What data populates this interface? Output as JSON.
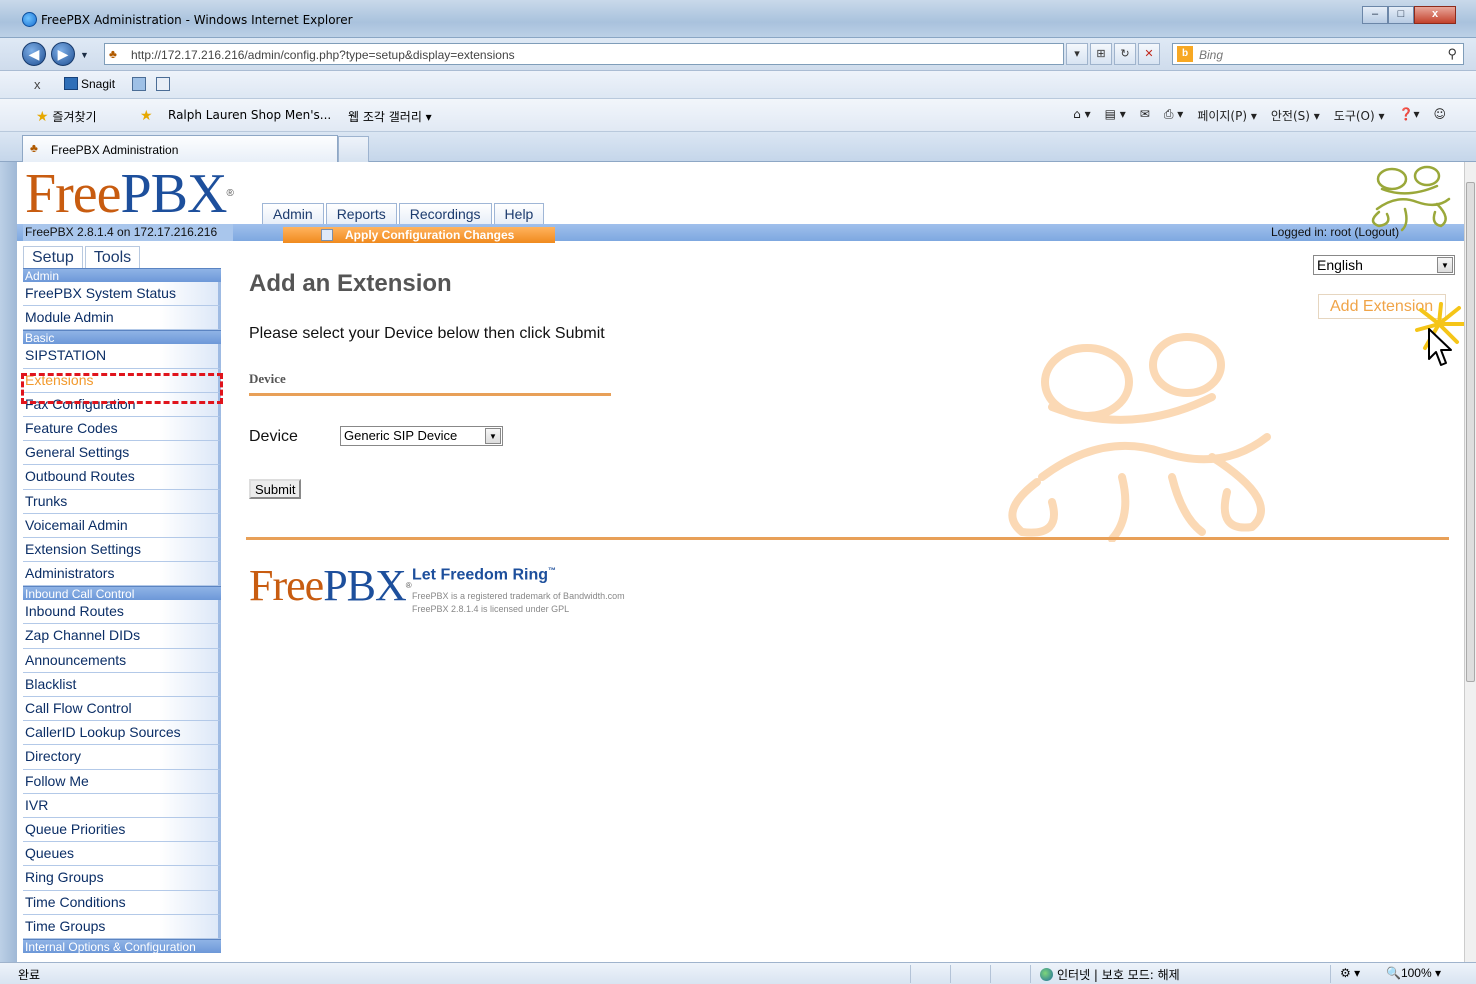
{
  "browser": {
    "window_title": "FreePBX Administration - Windows Internet Explorer",
    "url": "http://172.17.216.216/admin/config.php?type=setup&display=extensions",
    "search_placeholder": "Bing",
    "toolbar_close": "x",
    "snagit_label": "Snagit",
    "favorites_label": "즐겨찾기",
    "fav_link_1": "Ralph Lauren Shop Men's...",
    "fav_link_2": "웹 조각 갤러리 ▾",
    "cmd_page": "페이지(P) ▾",
    "cmd_safety": "안전(S) ▾",
    "cmd_tools": "도구(O) ▾",
    "tab_label": "FreePBX Administration",
    "status_left": "완료",
    "status_zone": "인터넷 | 보호 모드: 해제",
    "status_zoom": "100%"
  },
  "header": {
    "logo_free": "Free",
    "logo_pbx": "PBX",
    "logo_reg": "®",
    "version": "FreePBX 2.8.1.4 on 172.17.216.216",
    "nav_tabs": [
      "Admin",
      "Reports",
      "Recordings",
      "Help"
    ],
    "apply_label": "Apply Configuration Changes",
    "logged_in_prefix": "Logged in: root (",
    "logout_label": "Logout",
    "logged_in_suffix": ")"
  },
  "sidebar": {
    "tabs": [
      "Setup",
      "Tools"
    ],
    "sections": [
      {
        "title": "Admin",
        "items": [
          "FreePBX System Status",
          "Module Admin"
        ]
      },
      {
        "title": "Basic",
        "items": [
          "SIPSTATION",
          "Extensions",
          "Fax Configuration",
          "Feature Codes",
          "General Settings",
          "Outbound Routes",
          "Trunks",
          "Voicemail Admin",
          "Extension Settings",
          "Administrators"
        ]
      },
      {
        "title": "Inbound Call Control",
        "items": [
          "Inbound Routes",
          "Zap Channel DIDs",
          "Announcements",
          "Blacklist",
          "Call Flow Control",
          "CallerID Lookup Sources",
          "Directory",
          "Follow Me",
          "IVR",
          "Queue Priorities",
          "Queues",
          "Ring Groups",
          "Time Conditions",
          "Time Groups"
        ]
      },
      {
        "title": "Internal Options & Configuration",
        "items": []
      }
    ],
    "active_item": "Extensions"
  },
  "main": {
    "title": "Add an Extension",
    "instruction": "Please select your Device below then click Submit",
    "section_heading": "Device",
    "device_label": "Device",
    "device_selected": "Generic SIP Device",
    "submit_label": "Submit",
    "language_selected": "English",
    "add_extension_link": "Add Extension"
  },
  "footer": {
    "logo_free": "Free",
    "logo_pbx": "PBX",
    "logo_reg": "®",
    "slogan": "Let Freedom Ring",
    "slogan_tm": "™",
    "trademark_line": "FreePBX is a registered trademark of Bandwidth.com",
    "license_line": "FreePBX 2.8.1.4 is licensed under GPL"
  },
  "colors": {
    "orange_accent": "#e8a058",
    "blue_bar": "#7ea8e0",
    "active_item": "#f29a2e",
    "highlight_box": "#e0141c"
  }
}
